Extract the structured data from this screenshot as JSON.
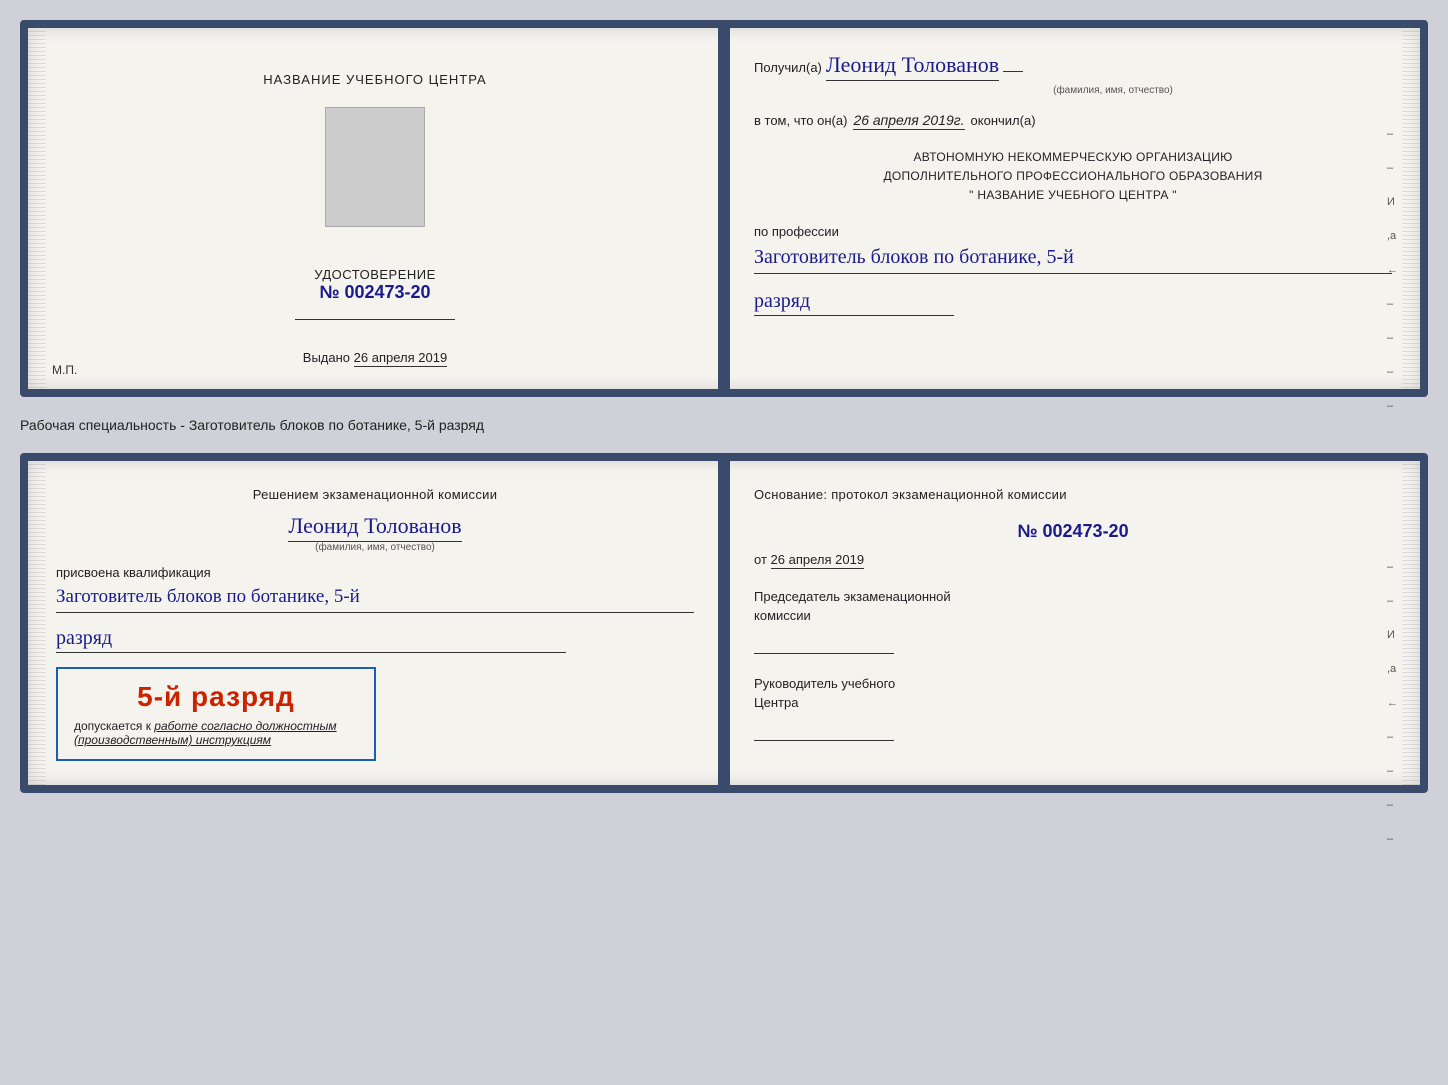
{
  "doc1": {
    "left": {
      "title": "НАЗВАНИЕ УЧЕБНОГО ЦЕНТРА",
      "cert_label": "УДОСТОВЕРЕНИЕ",
      "cert_no_prefix": "№",
      "cert_no": "002473-20",
      "vydano_label": "Выдано",
      "vydano_date": "26 апреля 2019",
      "mp_label": "М.П."
    },
    "right": {
      "poluchil_label": "Получил(а)",
      "name_handwritten": "Леонид Толованов",
      "fio_sub": "(фамилия, имя, отчество)",
      "vtom_prefix": "в том, что он(а)",
      "vtom_date": "26 апреля 2019г.",
      "okončil_label": "окончил(а)",
      "org_line1": "АВТОНОМНУЮ НЕКОММЕРЧЕСКУЮ ОРГАНИЗАЦИЮ",
      "org_line2": "ДОПОЛНИТЕЛЬНОГО ПРОФЕССИОНАЛЬНОГО ОБРАЗОВАНИЯ",
      "org_line3": "\" НАЗВАНИЕ УЧЕБНОГО ЦЕНТРА \"",
      "po_professii": "по профессии",
      "profession_handwritten": "Заготовитель блоков по ботанике, 5-й",
      "razryad_handwritten": "разряд"
    }
  },
  "specialty_label": "Рабочая специальность - Заготовитель блоков по ботанике, 5-й разряд",
  "doc2": {
    "left": {
      "resolution_line1": "Решением экзаменационной комиссии",
      "name_handwritten": "Леонид Толованов",
      "fio_sub": "(фамилия, имя, отчество)",
      "prisvoena": "присвоена квалификация",
      "profession_handwritten": "Заготовитель блоков по ботанике, 5-й",
      "razryad_handwritten": "разряд",
      "stamp_big": "5-й разряд",
      "dopuskaetsya": "допускается к",
      "work_label": "работе согласно должностным",
      "work_label2": "(производственным) инструкциям"
    },
    "right": {
      "osnov_label": "Основание: протокол экзаменационной комиссии",
      "no_prefix": "№",
      "protocol_no": "002473-20",
      "ot_prefix": "от",
      "ot_date": "26 апреля 2019",
      "chairman_line1": "Председатель экзаменационной",
      "chairman_line2": "комиссии",
      "rukovoditel_line1": "Руководитель учебного",
      "rukovoditel_line2": "Центра"
    }
  }
}
